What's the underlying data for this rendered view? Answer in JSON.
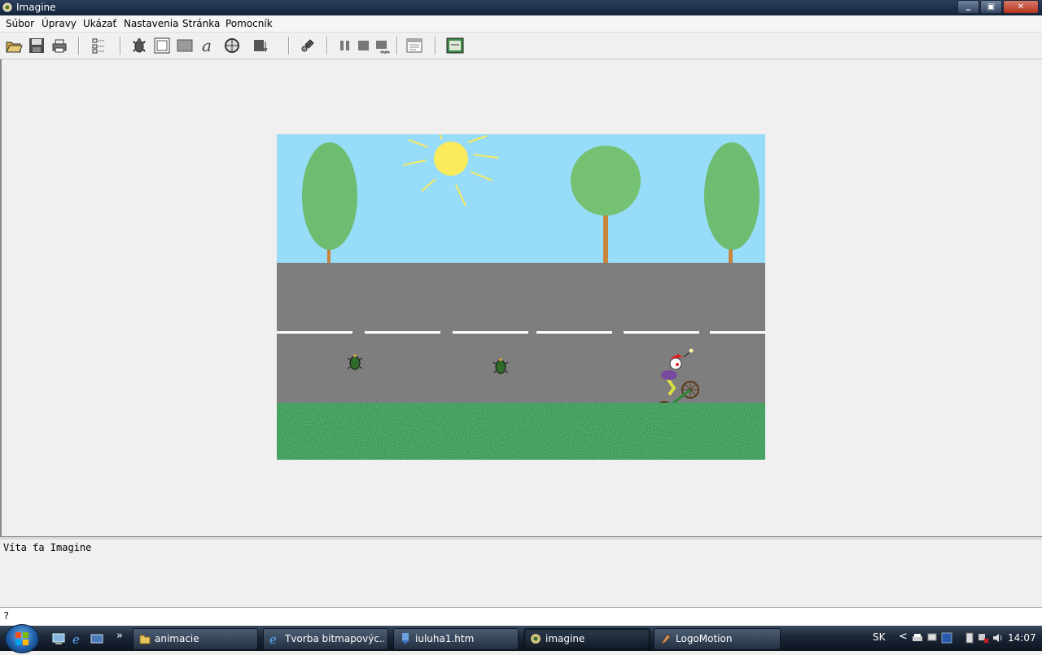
{
  "window": {
    "title": "Imagine",
    "minimize": "‗",
    "maximize": "▣",
    "close": "✕"
  },
  "menu": [
    "Súbor",
    "Úpravy",
    "Ukázať",
    "Nastavenia",
    "Stránka",
    "Pomocník"
  ],
  "toolbar": {
    "icons": [
      "open-folder-icon",
      "save-disk-icon",
      "print-icon",
      "tree-view-icon",
      "turtle-icon",
      "frame-icon",
      "panel-icon",
      "text-icon",
      "button-icon",
      "slider-icon",
      "plugin-icon",
      "pause-icon",
      "stop-icon",
      "run-icon",
      "properties-icon",
      "page-icon"
    ]
  },
  "output": {
    "welcome": "Víta ťa Imagine"
  },
  "command": {
    "prompt": "?"
  },
  "taskbar": {
    "quicklaunch_more": "»",
    "tasks": [
      {
        "label": "animacie",
        "icon": "folder-icon"
      },
      {
        "label": "Tvorba bitmapovýc...",
        "icon": "ie-icon"
      },
      {
        "label": "iuluha1.htm",
        "icon": "download-icon"
      },
      {
        "label": "imagine",
        "icon": "imagine-icon"
      },
      {
        "label": "LogoMotion",
        "icon": "logomotion-icon"
      }
    ],
    "language": "SK",
    "tray_arrow": "<",
    "clock": "14:07"
  }
}
